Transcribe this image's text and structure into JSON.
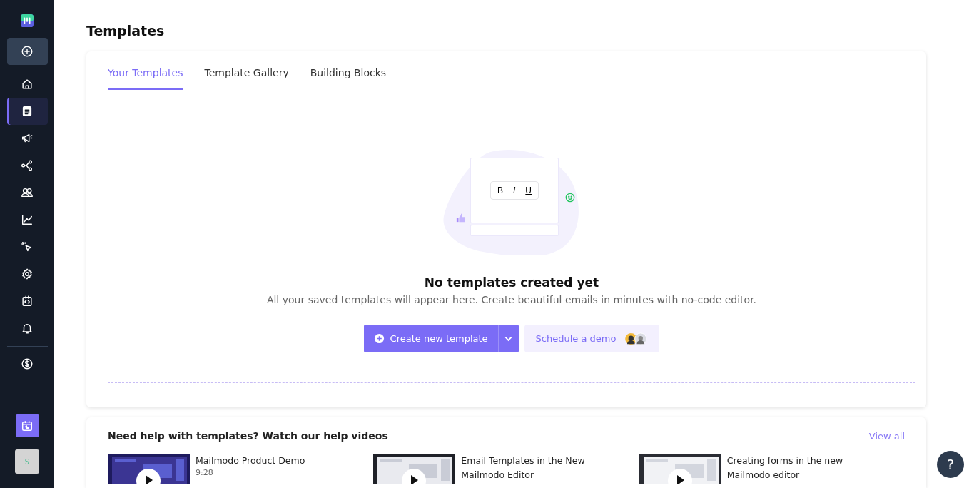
{
  "sidebar": {
    "items": [
      {
        "kind": "create",
        "selected": false
      },
      {
        "kind": "home",
        "selected": false
      },
      {
        "kind": "templates",
        "selected": true
      },
      {
        "kind": "megaphone",
        "selected": false
      },
      {
        "kind": "flow",
        "selected": false
      },
      {
        "kind": "people",
        "selected": false
      },
      {
        "kind": "chart",
        "selected": false
      },
      {
        "kind": "cursor",
        "selected": false
      },
      {
        "kind": "gear",
        "selected": false
      },
      {
        "kind": "code",
        "selected": false
      },
      {
        "kind": "bell",
        "selected": false
      }
    ],
    "footer_items": [
      {
        "kind": "dollar",
        "selected": false
      }
    ],
    "avatar": "S"
  },
  "page": {
    "title": "Templates"
  },
  "tabs": [
    {
      "label": "Your Templates",
      "selected": true
    },
    {
      "label": "Template Gallery",
      "selected": false
    },
    {
      "label": "Building Blocks",
      "selected": false
    }
  ],
  "empty_state": {
    "toolbar": [
      "B",
      "I",
      "U"
    ],
    "title": "No templates created yet",
    "description": "All your saved templates will appear here. Create beautiful emails in minutes with no-code editor.",
    "primary_button": "Create new template",
    "secondary_button": "Schedule a demo"
  },
  "help": {
    "title": "Need help with templates? Watch our help videos",
    "link": "View all",
    "videos": [
      {
        "title": "Mailmodo Product Demo",
        "duration": "9:28",
        "kind": "picture"
      },
      {
        "title": "Email Templates in the New Mailmodo Editor",
        "kind": "picture"
      },
      {
        "title": "Creating forms in the new Mailmodo editor",
        "kind": "picture"
      }
    ]
  },
  "help_button": "?"
}
